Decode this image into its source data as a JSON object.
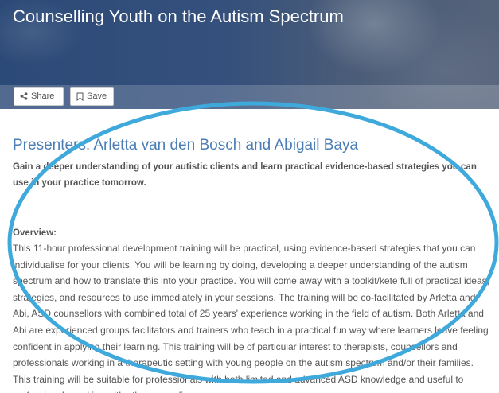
{
  "header": {
    "title": "Counselling Youth on the Autism Spectrum"
  },
  "actions": {
    "share_label": "Share",
    "save_label": "Save"
  },
  "content": {
    "presenters": "Presenters: Arletta van den Bosch and Abigail Baya",
    "lead": "Gain a deeper understanding of your autistic clients and learn practical evidence-based strategies you can use in your practice tomorrow.",
    "overview_label": "Overview:",
    "overview_text": "This 11-hour professional development training will be practical, using evidence-based strategies that you can individualise for your clients. You will be learning by doing, developing a deeper understanding of the autism spectrum and how to translate this into your practice. You will come away with a toolkit/kete full of practical ideas, strategies, and resources to use immediately in your sessions. The training will be co-facilitated by Arletta and Abi, ASD counsellors with combined total of 25 years' experience working in the field of autism. Both Arletta and Abi are experienced groups facilitators and trainers who teach in a practical fun way where learners leave feeling confident in applying their learning. This training will be of particular interest to therapists, counsellors and professionals working in a therapeutic setting with young people on the autism spectrum and/or their families. This training will be suitable for professionals with both limited and advanced ASD knowledge and useful to professionals working with other neurodiverse"
  },
  "colors": {
    "accent": "#4a7eb5",
    "annotation": "#3fa9dc",
    "body_text": "#555555"
  },
  "icons": {
    "share": "share-icon",
    "save": "bookmark-icon"
  }
}
